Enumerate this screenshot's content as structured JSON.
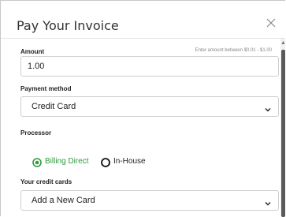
{
  "dialog": {
    "title": "Pay Your Invoice",
    "close_icon": "close-icon"
  },
  "amount": {
    "label": "Amount",
    "hint": "Enter amount between $0.01 - $1.00",
    "value": "1.00"
  },
  "payment_method": {
    "label": "Payment method",
    "selected": "Credit Card"
  },
  "processor": {
    "label": "Processor",
    "options": [
      {
        "label": "Billing Direct",
        "selected": true
      },
      {
        "label": "In-House",
        "selected": false
      }
    ]
  },
  "credit_cards": {
    "label": "Your credit cards",
    "selected": "Add a New Card"
  },
  "colors": {
    "accent_green": "#2e9a3e",
    "text_dark": "#222222"
  }
}
